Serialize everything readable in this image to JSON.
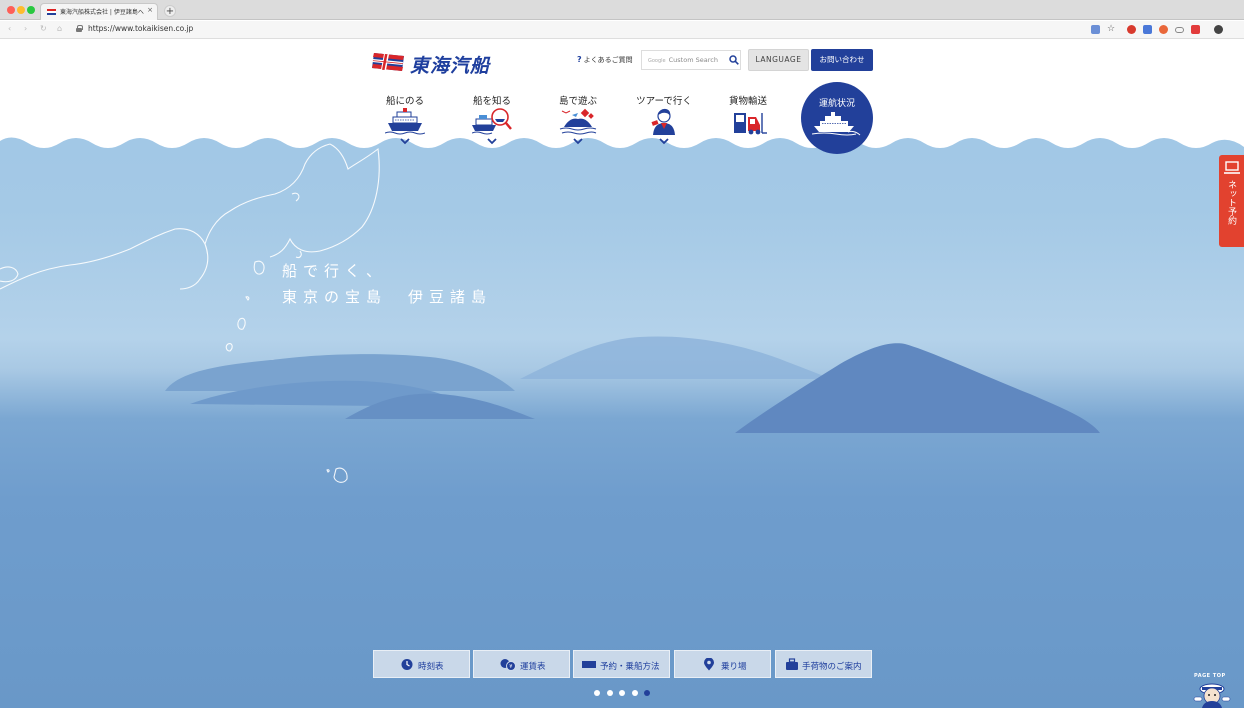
{
  "browser": {
    "tab_title": "東海汽船株式会社 | 伊豆諸島へ",
    "tab_close": "×",
    "new_tab": "+",
    "url": "https://www.tokaikisen.co.jp",
    "nav_back": "‹",
    "nav_forward": "›",
    "nav_reload": "↻",
    "nav_home": "⌂"
  },
  "header": {
    "logo_text": "東海汽船",
    "faq_mark": "?",
    "faq_label": "よくあるご質問",
    "search_brand": "Google",
    "search_placeholder": "Custom Search",
    "language_label": "LANGUAGE",
    "contact_label": "お問い合わせ"
  },
  "nav": {
    "items": [
      {
        "label": "船にのる",
        "icon": "ferry-icon"
      },
      {
        "label": "船を知る",
        "icon": "magnifier-ship-icon"
      },
      {
        "label": "島で遊ぶ",
        "icon": "island-icon"
      },
      {
        "label": "ツアーで行く",
        "icon": "guide-person-icon"
      },
      {
        "label": "貨物輸送",
        "icon": "forklift-icon"
      }
    ],
    "status_label": "運航状況"
  },
  "hero": {
    "tagline_line1": "船で行く、",
    "tagline_line2": "東京の宝島　伊豆諸島"
  },
  "side_tab": {
    "label": "ネット予約"
  },
  "quick_links": [
    {
      "label": "時刻表",
      "icon": "clock-icon"
    },
    {
      "label": "運賃表",
      "icon": "coins-icon"
    },
    {
      "label": "予約・乗船方法",
      "icon": "ticket-icon"
    },
    {
      "label": "乗り場",
      "icon": "map-pin-icon"
    },
    {
      "label": "手荷物のご案内",
      "icon": "luggage-icon"
    }
  ],
  "carousel": {
    "count": 5,
    "active_index": 4
  },
  "pagetop_label": "PAGE TOP",
  "colors": {
    "brand_blue": "#22409a",
    "accent_red": "#e2422f",
    "sea": "#6998c8",
    "sky": "#a4c9e6"
  }
}
